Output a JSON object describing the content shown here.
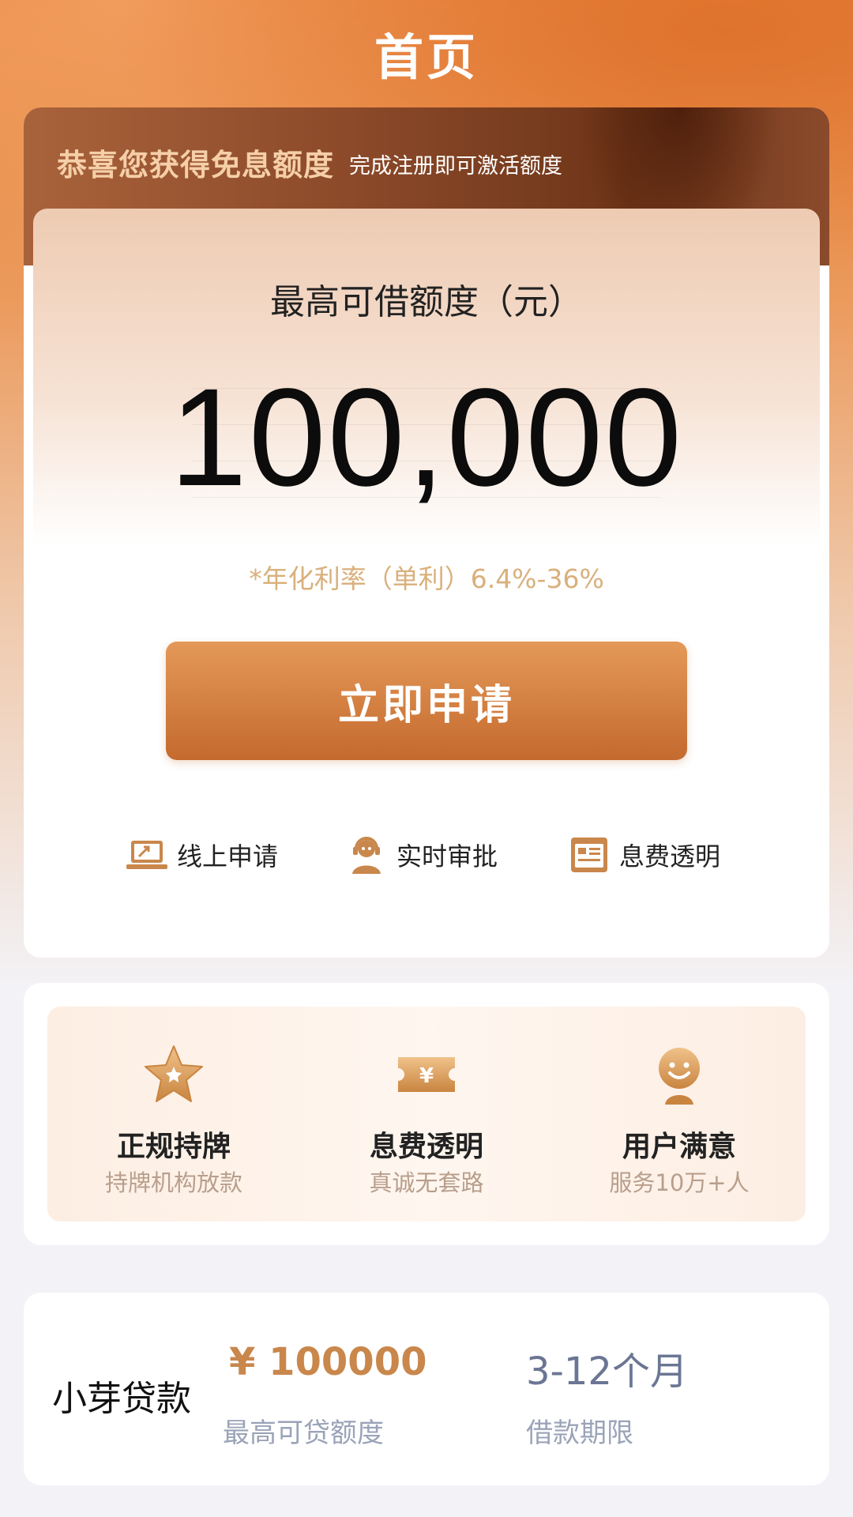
{
  "header": {
    "title": "首页"
  },
  "hero": {
    "banner_title": "恭喜您获得免息额度",
    "banner_subtitle": "完成注册即可激活额度",
    "limit_label": "最高可借额度（元）",
    "limit_amount": "100,000",
    "rate_note": "*年化利率（单利）6.4%-36%",
    "apply_button": "立即申请",
    "features": [
      {
        "label": "线上申请",
        "icon": "laptop-icon"
      },
      {
        "label": "实时审批",
        "icon": "support-agent-icon"
      },
      {
        "label": "息费透明",
        "icon": "document-icon"
      }
    ]
  },
  "trust": {
    "items": [
      {
        "title": "正规持牌",
        "subtitle": "持牌机构放款",
        "icon": "star-icon"
      },
      {
        "title": "息费透明",
        "subtitle": "真诚无套路",
        "icon": "yen-ticket-icon"
      },
      {
        "title": "用户满意",
        "subtitle": "服务10万+人",
        "icon": "smiley-icon"
      }
    ]
  },
  "loan": {
    "name": "小芽贷款",
    "amount": "¥ 100000",
    "amount_label": "最高可贷额度",
    "term": "3-12个月",
    "term_label": "借款期限"
  },
  "colors": {
    "accent": "#d07a3a",
    "gold": "#c9874c",
    "rate_text": "#d9b07c"
  }
}
